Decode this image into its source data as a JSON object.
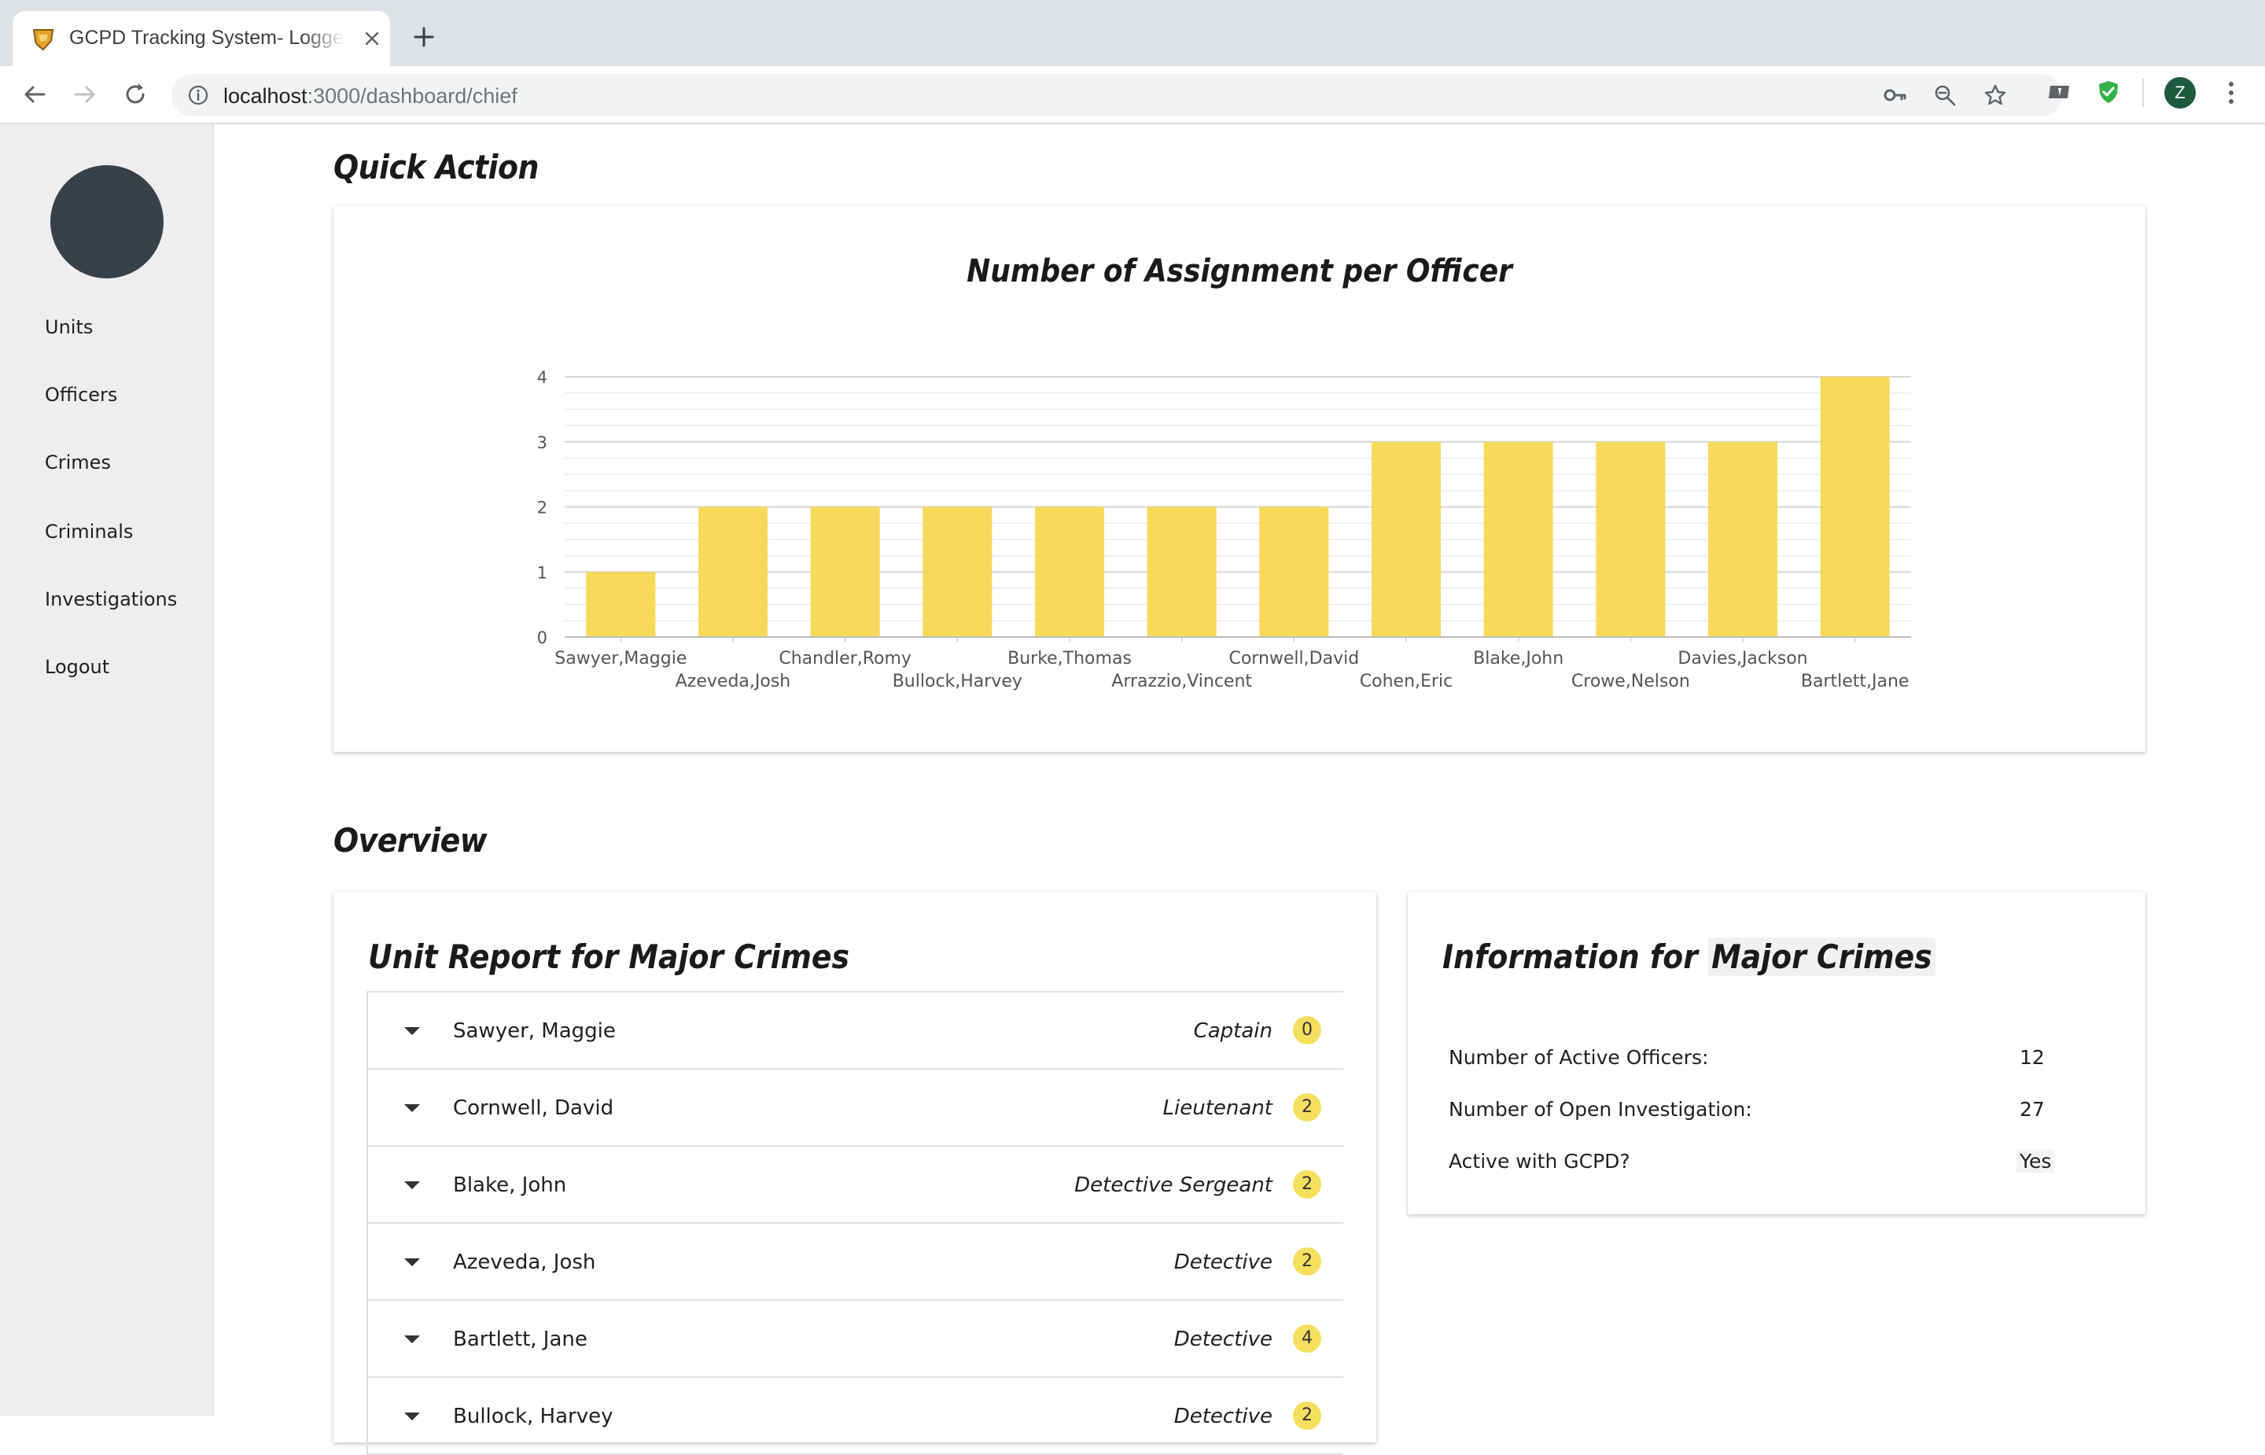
{
  "browser": {
    "tab_title": "GCPD Tracking System- Logged in",
    "url_host": "localhost",
    "url_rest": ":3000/dashboard/chief",
    "profile_initial": "Z"
  },
  "sidebar": {
    "items": [
      {
        "label": "Units"
      },
      {
        "label": "Officers"
      },
      {
        "label": "Crimes"
      },
      {
        "label": "Criminals"
      },
      {
        "label": "Investigations"
      },
      {
        "label": "Logout"
      }
    ]
  },
  "quick_action": {
    "section_title": "Quick Action"
  },
  "chart_data": {
    "type": "bar",
    "title": "Number of Assignment per Officer",
    "xlabel": "",
    "ylabel": "",
    "categories": [
      "Sawyer,Maggie",
      "Azeveda,Josh",
      "Chandler,Romy",
      "Bullock,Harvey",
      "Burke,Thomas",
      "Arrazzio,Vincent",
      "Cornwell,David",
      "Cohen,Eric",
      "Blake,John",
      "Crowe,Nelson",
      "Davies,Jackson",
      "Bartlett,Jane"
    ],
    "values": [
      1,
      2,
      2,
      2,
      2,
      2,
      2,
      3,
      3,
      3,
      3,
      4
    ],
    "ylim": [
      0,
      4
    ],
    "yticks": [
      "0",
      "1",
      "2",
      "3",
      "4"
    ],
    "grid": true,
    "bar_color": "#f7d95c",
    "legend": "none"
  },
  "overview": {
    "section_title": "Overview",
    "unit_report": {
      "title": "Unit Report for Major Crimes",
      "rows": [
        {
          "name": "Sawyer, Maggie",
          "rank": "Captain",
          "count": "0"
        },
        {
          "name": "Cornwell, David",
          "rank": "Lieutenant",
          "count": "2"
        },
        {
          "name": "Blake, John",
          "rank": "Detective Sergeant",
          "count": "2"
        },
        {
          "name": "Azeveda, Josh",
          "rank": "Detective",
          "count": "2"
        },
        {
          "name": "Bartlett, Jane",
          "rank": "Detective",
          "count": "4"
        },
        {
          "name": "Bullock, Harvey",
          "rank": "Detective",
          "count": "2"
        }
      ]
    },
    "info": {
      "title_prefix": "Information for ",
      "title_unit": "Major Crimes",
      "rows": [
        {
          "label": "Number of Active Officers:",
          "value": "12"
        },
        {
          "label": "Number of Open Investigation:",
          "value": "27"
        },
        {
          "label": "Active with GCPD?",
          "value": "Yes"
        }
      ]
    }
  },
  "colors": {
    "accent_yellow": "#f7d95c",
    "badge_yellow": "#f7df5e",
    "sidebar_bg": "#eeeeee"
  }
}
